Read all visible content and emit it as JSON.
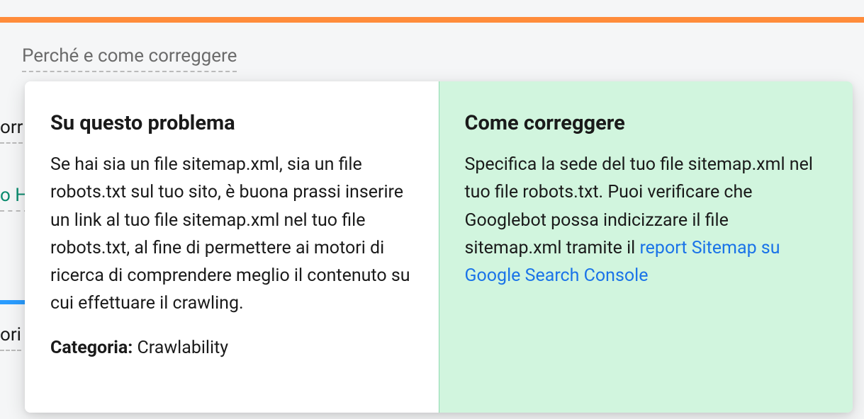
{
  "background": {
    "snippet1": "orr",
    "snippet2": "o H",
    "snippet3": "ori"
  },
  "tooltip_trigger": "Perché e come correggere",
  "popup": {
    "left": {
      "heading": "Su questo problema",
      "body": "Se hai sia un file sitemap.xml, sia un file robots.txt sul tuo sito, è buona prassi inserire un link al tuo file sitemap.xml nel tuo file robots.txt, al fine di permettere ai motori di ricerca di comprendere meglio il contenuto su cui effettuare il crawling.",
      "category_label": "Categoria:",
      "category_value": "Crawlability"
    },
    "right": {
      "heading": "Come correggere",
      "body_before_link": "Specifica la sede del tuo file sitemap.xml nel tuo file robots.txt. Puoi verificare che Googlebot possa indicizzare il file sitemap.xml tramite il ",
      "link_text": "report Sitemap su Google Search Console"
    }
  }
}
